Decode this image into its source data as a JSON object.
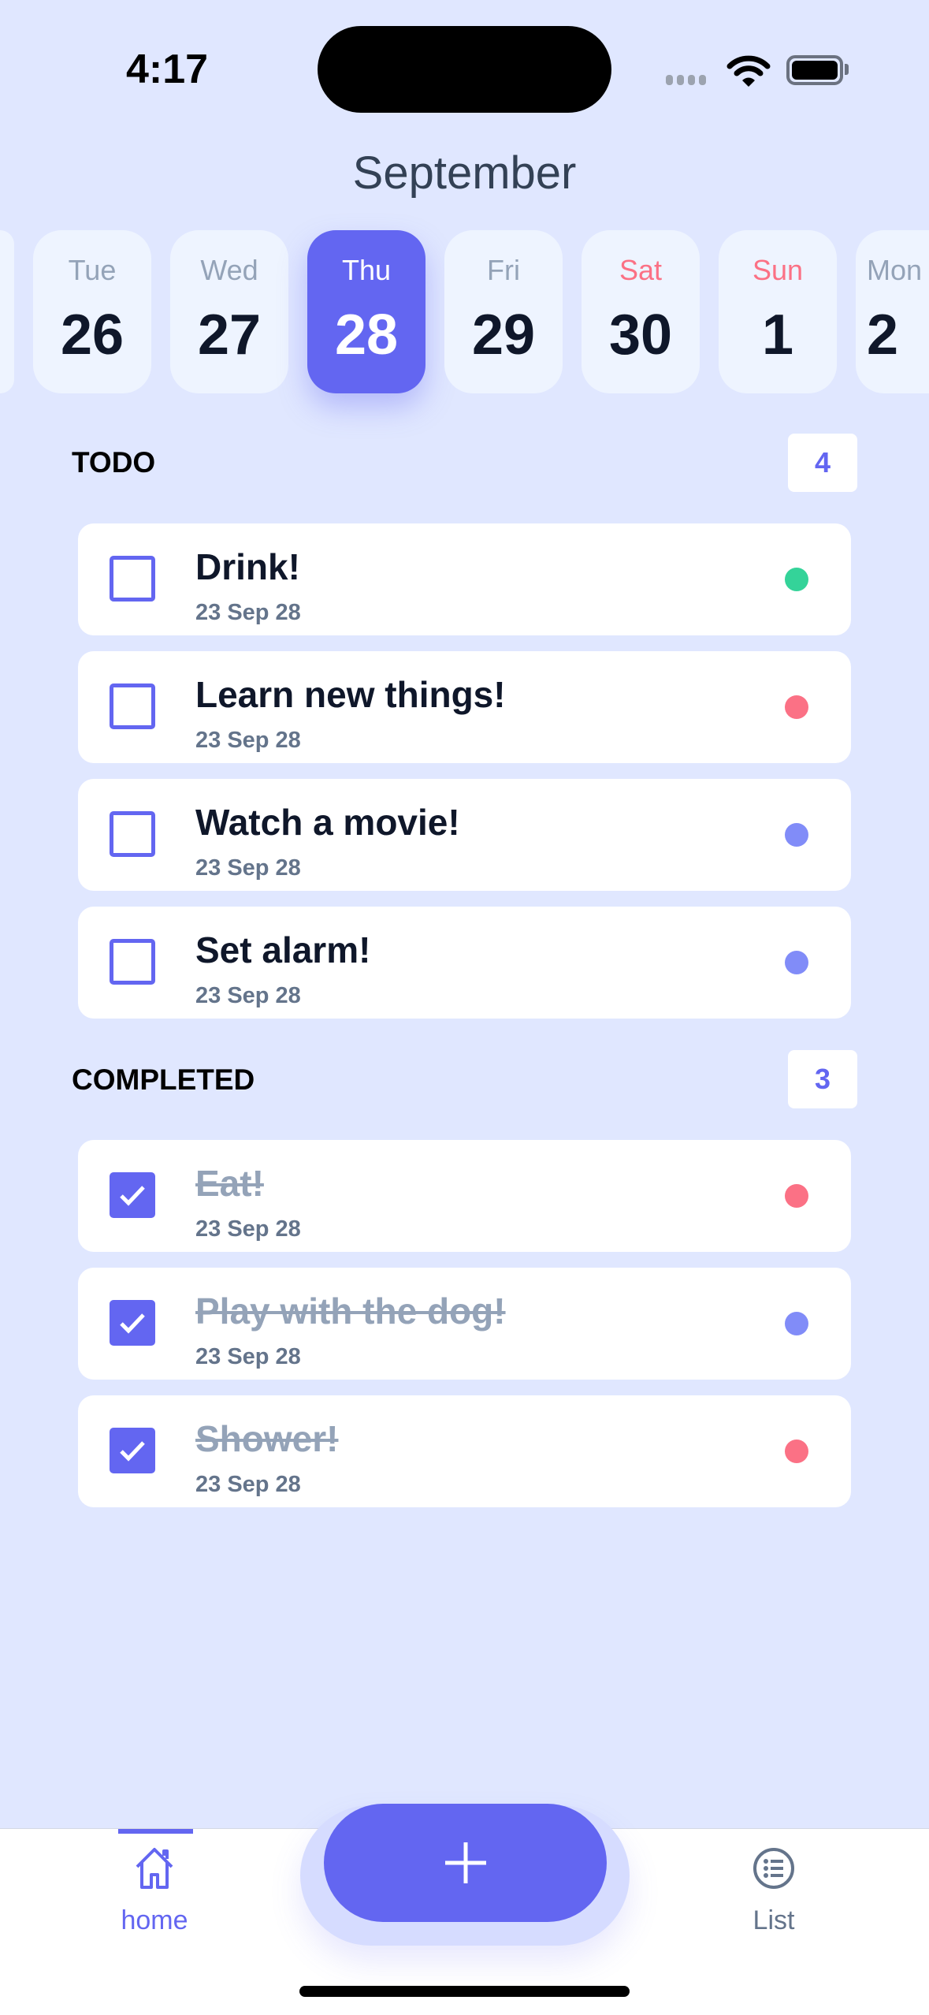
{
  "status_bar": {
    "time": "4:17"
  },
  "header": {
    "month": "September"
  },
  "days": [
    {
      "name": "",
      "date": "",
      "weekend": false,
      "selected": false
    },
    {
      "name": "Tue",
      "date": "26",
      "weekend": false,
      "selected": false
    },
    {
      "name": "Wed",
      "date": "27",
      "weekend": false,
      "selected": false
    },
    {
      "name": "Thu",
      "date": "28",
      "weekend": false,
      "selected": true
    },
    {
      "name": "Fri",
      "date": "29",
      "weekend": false,
      "selected": false
    },
    {
      "name": "Sat",
      "date": "30",
      "weekend": true,
      "selected": false
    },
    {
      "name": "Sun",
      "date": "1",
      "weekend": true,
      "selected": false
    },
    {
      "name": "Mon",
      "date": "2",
      "weekend": false,
      "selected": false
    }
  ],
  "todo": {
    "title": "TODO",
    "count": "4",
    "items": [
      {
        "title": "Drink!",
        "date": "23 Sep 28",
        "color": "#34d399"
      },
      {
        "title": "Learn new things!",
        "date": "23 Sep 28",
        "color": "#fb7185"
      },
      {
        "title": "Watch a movie!",
        "date": "23 Sep 28",
        "color": "#818cf8"
      },
      {
        "title": "Set alarm!",
        "date": "23 Sep 28",
        "color": "#818cf8"
      }
    ]
  },
  "completed": {
    "title": "COMPLETED",
    "count": "3",
    "items": [
      {
        "title": "Eat!",
        "date": "23 Sep 28",
        "color": "#fb7185"
      },
      {
        "title": "Play with the dog!",
        "date": "23 Sep 28",
        "color": "#818cf8"
      },
      {
        "title": "Shower!",
        "date": "23 Sep 28",
        "color": "#fb7185"
      }
    ]
  },
  "tabbar": {
    "home": "home",
    "list": "List",
    "accent": "#6366f1"
  }
}
